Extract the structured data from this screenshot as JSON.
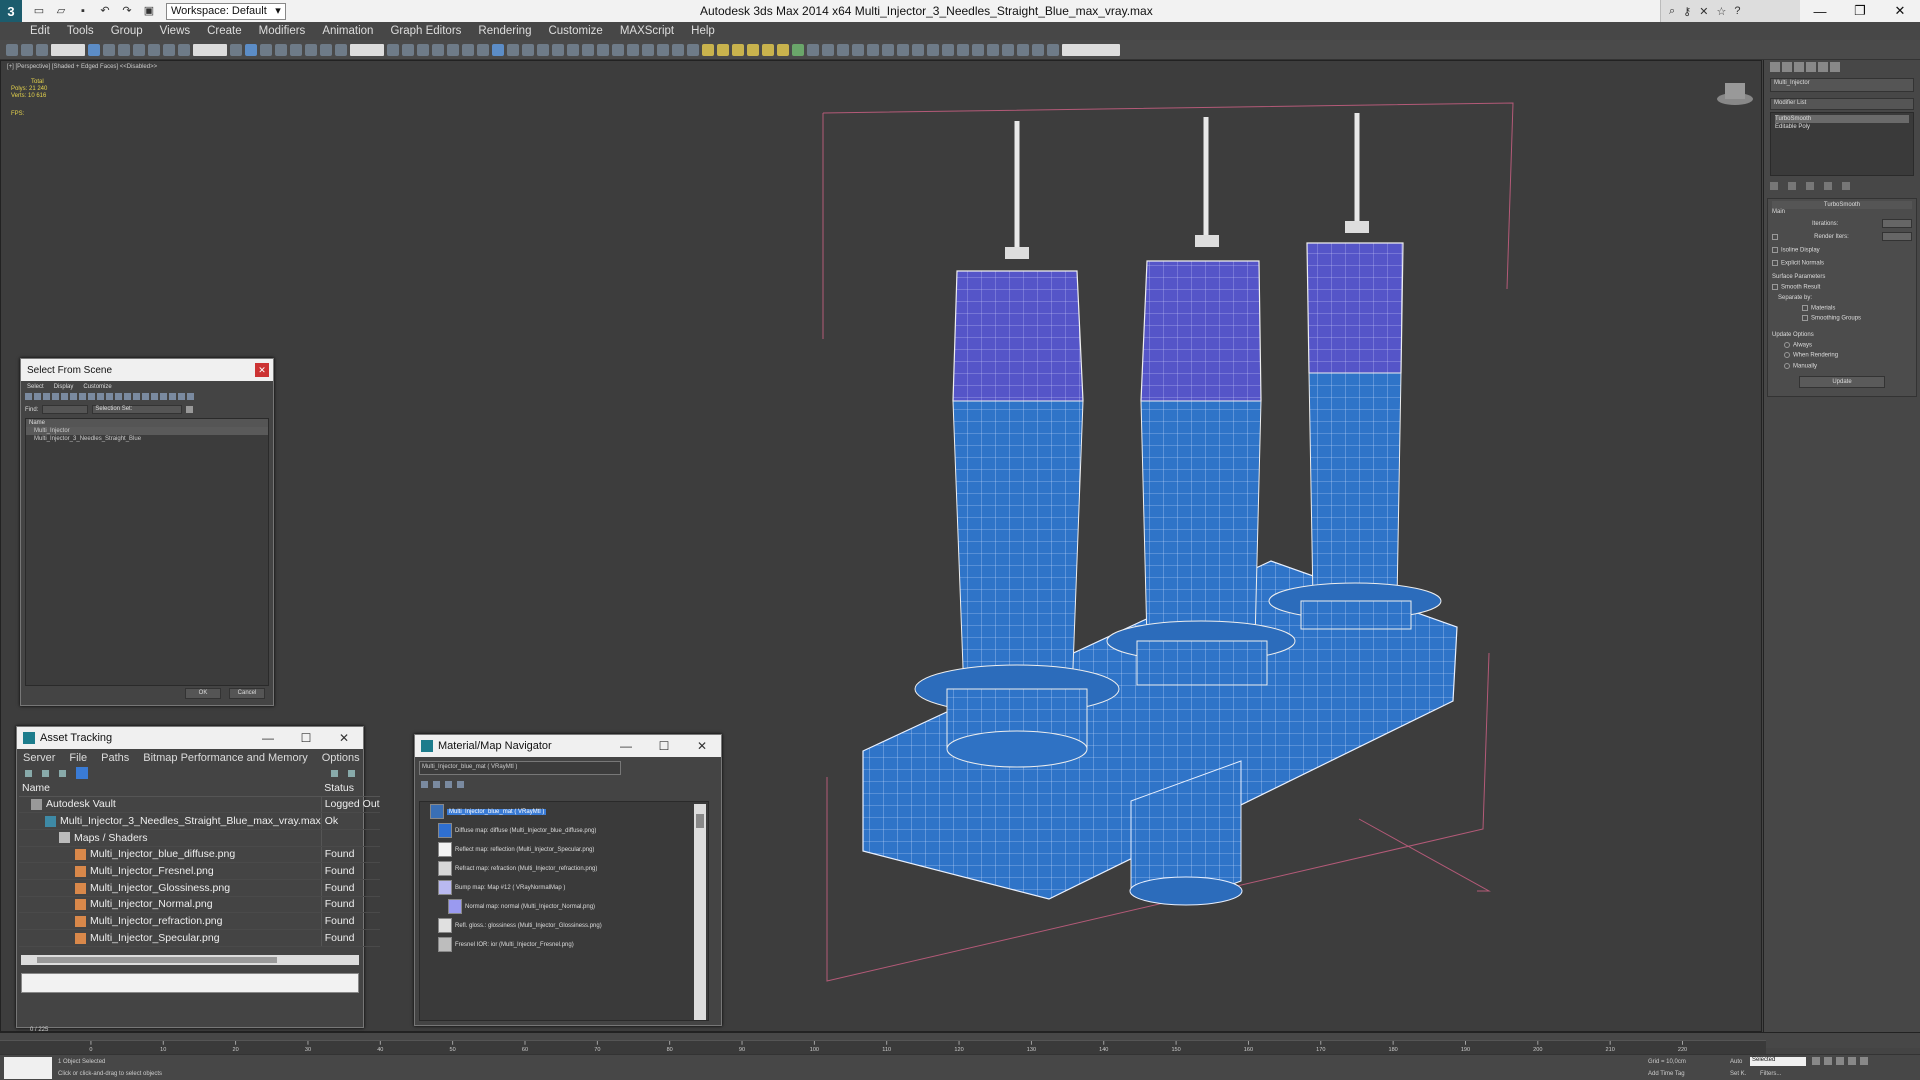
{
  "titlebar": {
    "workspace": "Workspace: Default",
    "title": "Autodesk 3ds Max  2014 x64      Multi_Injector_3_Needles_Straight_Blue_max_vray.max"
  },
  "menu": [
    "Edit",
    "Tools",
    "Group",
    "Views",
    "Create",
    "Modifiers",
    "Animation",
    "Graph Editors",
    "Rendering",
    "Customize",
    "MAXScript",
    "Help"
  ],
  "viewport": {
    "label": "[+] [Perspective] [Shaded + Edged Faces]  <<Disabled>>",
    "stats_total": "Total",
    "stats_polys": "Polys:  21 240",
    "stats_verts": "Verts:  10 616",
    "fps": "FPS:"
  },
  "command_panel": {
    "object_name": "Multi_Injector",
    "modifier_list": "Modifier List",
    "stack": [
      "TurboSmooth",
      "Editable Poly"
    ],
    "rollout_title": "TurboSmooth",
    "main": "Main",
    "iterations": "Iterations:",
    "render_iters": "Render Iters:",
    "isoline_display": "Isoline Display",
    "explicit_normals": "Explicit Normals",
    "surface_params": "Surface Parameters",
    "smooth_result": "Smooth Result",
    "separate_by": "Separate by:",
    "materials": "Materials",
    "smoothing_groups": "Smoothing Groups",
    "update_options": "Update Options",
    "always": "Always",
    "when_rendering": "When Rendering",
    "manually": "Manually",
    "update": "Update"
  },
  "select_from_scene": {
    "title": "Select From Scene",
    "menu": [
      "Select",
      "Display",
      "Customize"
    ],
    "find": "Find:",
    "selection_set": "Selection Set:",
    "name_header": "Name",
    "items": [
      "Multi_Injector",
      "Multi_Injector_3_Needles_Straight_Blue"
    ],
    "ok": "OK",
    "cancel": "Cancel"
  },
  "asset_tracking": {
    "title": "Asset Tracking",
    "menu": [
      "Server",
      "File",
      "Paths",
      "Bitmap Performance and Memory",
      "Options"
    ],
    "col_name": "Name",
    "col_status": "Status",
    "rows": [
      {
        "name": "Autodesk Vault",
        "status": "Logged Out"
      },
      {
        "name": "Multi_Injector_3_Needles_Straight_Blue_max_vray.max",
        "status": "Ok"
      },
      {
        "name": "Maps / Shaders",
        "status": ""
      },
      {
        "name": "Multi_Injector_blue_diffuse.png",
        "status": "Found"
      },
      {
        "name": "Multi_Injector_Fresnel.png",
        "status": "Found"
      },
      {
        "name": "Multi_Injector_Glossiness.png",
        "status": "Found"
      },
      {
        "name": "Multi_Injector_Normal.png",
        "status": "Found"
      },
      {
        "name": "Multi_Injector_refraction.png",
        "status": "Found"
      },
      {
        "name": "Multi_Injector_Specular.png",
        "status": "Found"
      }
    ]
  },
  "material_navigator": {
    "title": "Material/Map Navigator",
    "name_field": "Multi_Injector_blue_mat  ( VRayMtl )",
    "nodes": [
      {
        "label": "Multi_Injector_blue_mat  ( VRayMtl )",
        "color": "#3a6fb5"
      },
      {
        "label": "Diffuse map: diffuse (Multi_Injector_blue_diffuse.png)",
        "color": "#2f6fd0"
      },
      {
        "label": "Reflect map: reflection (Multi_Injector_Specular.png)",
        "color": "#f4f4f4"
      },
      {
        "label": "Refract map: refraction (Multi_Injector_refraction.png)",
        "color": "#d8d8d8"
      },
      {
        "label": "Bump map: Map #12  ( VRayNormalMap )",
        "color": "#b9b9f0"
      },
      {
        "label": "Normal map: normal (Multi_Injector_Normal.png)",
        "color": "#9a9af0"
      },
      {
        "label": "Refl. gloss.: glossiness (Multi_Injector_Glossiness.png)",
        "color": "#e0e0e0"
      },
      {
        "label": "Fresnel IOR: ior (Multi_Injector_Fresnel.png)",
        "color": "#bdbdbd"
      }
    ]
  },
  "timeline": {
    "frame": "0 / 225",
    "ticks": [
      "0",
      "10",
      "20",
      "30",
      "40",
      "50",
      "60",
      "70",
      "80",
      "90",
      "100",
      "110",
      "120",
      "130",
      "140",
      "150",
      "160",
      "170",
      "180",
      "190",
      "200",
      "210",
      "220"
    ]
  },
  "status": {
    "selected": "1 Object Selected",
    "hint": "Click or click-and-drag to select objects",
    "grid": "Grid = 10,0cm",
    "add_time_tag": "Add Time Tag",
    "auto": "Auto",
    "set_k": "Set K.",
    "selected_dropdown": "Selected",
    "filters": "Filters..."
  }
}
